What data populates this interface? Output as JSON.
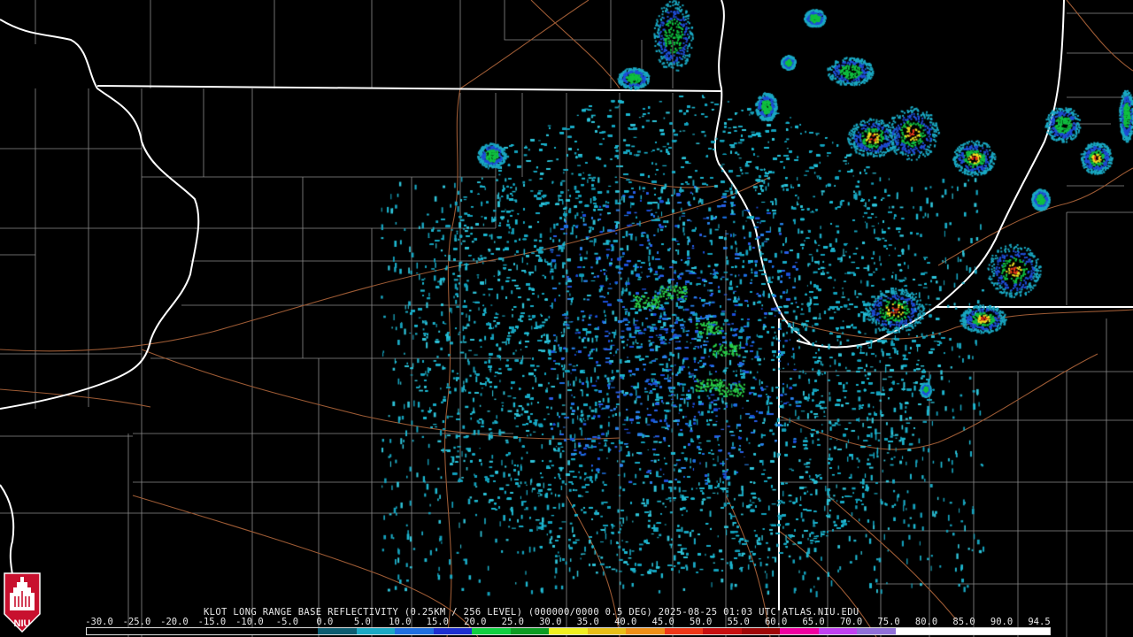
{
  "product": {
    "caption": "KLOT LONG RANGE BASE REFLECTIVITY (0.25KM / 256 LEVEL) (000000/0000 0.5 DEG) 2025-08-25 01:03 UTC  ATLAS.NIU.EDU"
  },
  "scale": {
    "ticks": [
      "-30.0",
      "-25.0",
      "-20.0",
      "-15.0",
      "-10.0",
      "-5.0",
      "0.0",
      "5.0",
      "10.0",
      "15.0",
      "20.0",
      "25.0",
      "30.0",
      "35.0",
      "40.0",
      "45.0",
      "50.0",
      "55.0",
      "60.0",
      "65.0",
      "70.0",
      "75.0",
      "80.0",
      "85.0",
      "90.0",
      "94.5"
    ],
    "colors": [
      "#000000",
      "#000000",
      "#000000",
      "#000000",
      "#000000",
      "#000000",
      "#0c5c70",
      "#1aa9c4",
      "#1f6fe0",
      "#1d2fd0",
      "#10d040",
      "#0c9c22",
      "#f0f020",
      "#e8c018",
      "#f09018",
      "#f03818",
      "#c81010",
      "#a00808",
      "#f000a0",
      "#c040f0",
      "#9070d8",
      "#ffffff",
      "#ffffff",
      "#ffffff",
      "#ffffff"
    ]
  },
  "logo": {
    "text": "NIU"
  }
}
